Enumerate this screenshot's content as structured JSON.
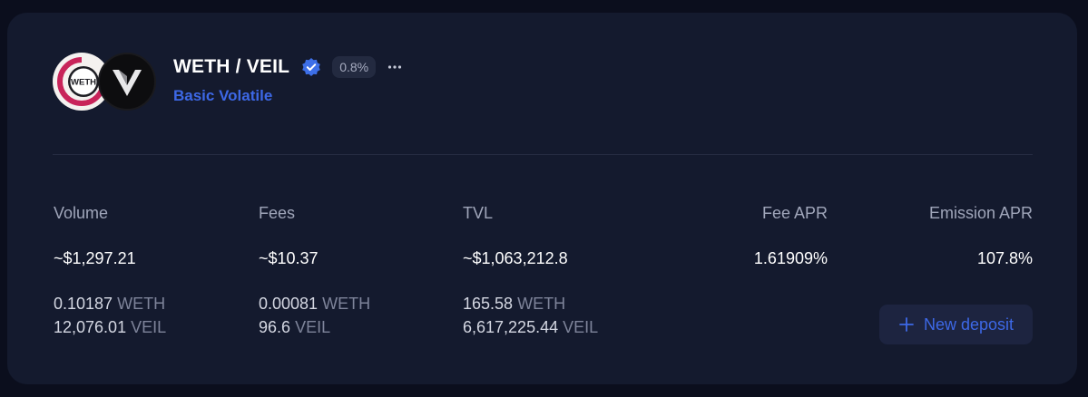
{
  "pool": {
    "pair_name": "WETH / VEIL",
    "fee_badge": "0.8%",
    "pool_type": "Basic Volatile",
    "token0": {
      "logo_text": "WETH",
      "icon": "weth-logo-icon"
    },
    "token1": {
      "icon": "veil-logo-icon"
    },
    "verified_icon": "verified-check-icon",
    "more_icon": "more-horizontal-icon"
  },
  "stats": {
    "volume": {
      "label": "Volume",
      "value": "~$1,297.21",
      "token0_amount": "0.10187",
      "token0_unit": "WETH",
      "token1_amount": "12,076.01",
      "token1_unit": "VEIL"
    },
    "fees": {
      "label": "Fees",
      "value": "~$10.37",
      "token0_amount": "0.00081",
      "token0_unit": "WETH",
      "token1_amount": "96.6",
      "token1_unit": "VEIL"
    },
    "tvl": {
      "label": "TVL",
      "value": "~$1,063,212.8",
      "token0_amount": "165.58",
      "token0_unit": "WETH",
      "token1_amount": "6,617,225.44",
      "token1_unit": "VEIL"
    },
    "fee_apr": {
      "label": "Fee APR",
      "value": "1.61909%"
    },
    "emission_apr": {
      "label": "Emission APR",
      "value": "107.8%"
    }
  },
  "actions": {
    "new_deposit_label": "New deposit",
    "new_deposit_icon": "plus-icon"
  },
  "colors": {
    "background": "#0b0e1d",
    "card": "#141a2e",
    "accent": "#3d68e6",
    "muted_text": "#a0a6ba"
  }
}
